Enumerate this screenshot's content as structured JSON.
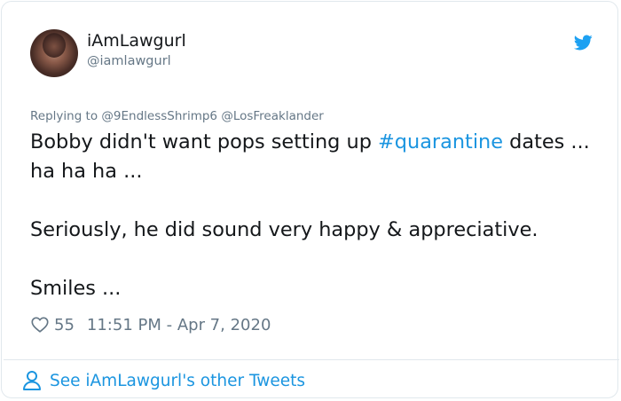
{
  "author": {
    "name": "iAmLawgurl",
    "handle": "@iamlawgurl"
  },
  "reply": {
    "prefix": "Replying to ",
    "mentions": [
      "@9EndlessShrimp6",
      "@LosFreaklander"
    ]
  },
  "tweet": {
    "line1_before": "Bobby didn't want pops setting up ",
    "hashtag": "#quarantine",
    "line1_after": " dates ... ha ha ha ...",
    "paragraph2": "Seriously, he did sound very happy & appreciative.",
    "paragraph3": "Smiles ..."
  },
  "meta": {
    "likes": "55",
    "timestamp": "11:51 PM - Apr 7, 2020"
  },
  "footer": {
    "link_text": "See iAmLawgurl's other Tweets"
  },
  "icons": {
    "brand": "twitter-bird-icon",
    "like": "heart-icon",
    "profile": "person-icon"
  },
  "colors": {
    "text": "#14171a",
    "secondary": "#657786",
    "link": "#1b95e0",
    "brand": "#1da1f2",
    "border": "#e1e8ed"
  }
}
